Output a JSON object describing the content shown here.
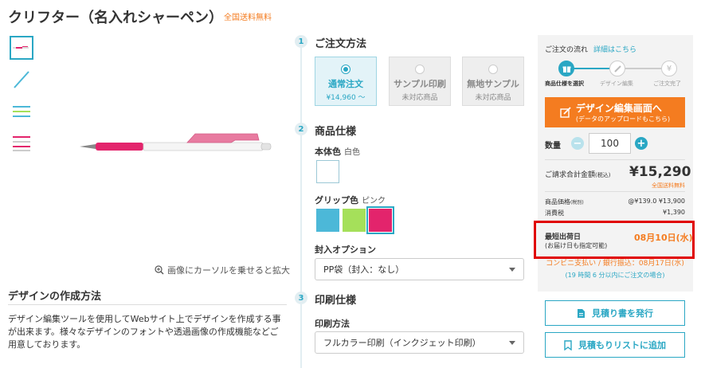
{
  "product": {
    "title": "クリフター（名入れシャーペン）",
    "free_shipping_tag": "全国送料無料"
  },
  "gallery": {
    "zoom_hint": "画像にカーソルを乗せると拡大"
  },
  "design_section": {
    "heading": "デザインの作成方法",
    "description": "デザイン編集ツールを使用してWebサイト上でデザインを作成する事が出来ます。様々なデザインのフォントや透過画像の作成機能などご用意しております。"
  },
  "steps": [
    {
      "num": "1",
      "title": "ご注文方法"
    },
    {
      "num": "2",
      "title": "商品仕様"
    },
    {
      "num": "3",
      "title": "印刷仕様"
    }
  ],
  "order_methods": [
    {
      "label": "通常注文",
      "sub": "¥14,960 ～",
      "selected": true
    },
    {
      "label": "サンプル印刷",
      "sub": "未対応商品",
      "selected": false
    },
    {
      "label": "無地サンプル",
      "sub": "未対応商品",
      "selected": false
    }
  ],
  "spec": {
    "body_color_label": "本体色",
    "body_color_value": "白色",
    "body_color_hex": "#ffffff",
    "grip_color_label": "グリップ色",
    "grip_color_value": "ピンク",
    "grip_colors": [
      "#4cb8d8",
      "#a5e05a",
      "#e3246c"
    ],
    "packaging_label": "封入オプション",
    "packaging_value": "PP袋（封入：なし）"
  },
  "print_spec": {
    "method_label": "印刷方法",
    "method_value": "フルカラー印刷（インクジェット印刷）"
  },
  "flow": {
    "title": "ご注文の流れ",
    "link": "詳細はこちら",
    "steps": [
      "商品仕様を選択",
      "デザイン編集",
      "ご注文完了"
    ]
  },
  "design_button": {
    "line1": "デザイン編集画面へ",
    "line2": "(データのアップロードもこちら)"
  },
  "quantity": {
    "label": "数量",
    "value": "100"
  },
  "totals": {
    "label": "ご請求合計金額",
    "label_tax": "(税込)",
    "value": "¥15,290",
    "free_shipping": "全国送料無料",
    "item_price_label": "商品価格",
    "item_price_tax": "(税別)",
    "item_price_value": "@¥139.0 ¥13,900",
    "tax_label": "消費税",
    "tax_value": "¥1,390"
  },
  "shipping": {
    "label": "最短出荷日",
    "sub": "(お届け日も指定可能)",
    "date": "08月10日(水)",
    "convenience_note": "コンビニ支払い / 銀行振込：08月17日(水)",
    "time_note": "(19 時間 6 分以内にご注文の場合)"
  },
  "buttons": {
    "estimate": "見積り書を発行",
    "add_list": "見積もりリストに追加"
  },
  "colors": {
    "accent": "#2aa7c4",
    "orange": "#f47c20",
    "highlight_red": "#e00000"
  }
}
